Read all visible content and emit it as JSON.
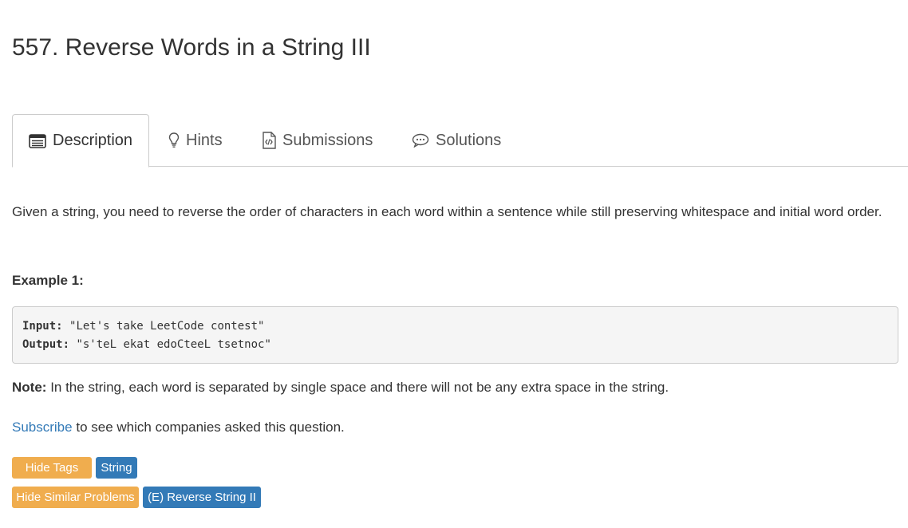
{
  "problem": {
    "title": "557. Reverse Words in a String III"
  },
  "tabs": [
    {
      "label": "Description",
      "icon": "description-icon",
      "active": true
    },
    {
      "label": "Hints",
      "icon": "lightbulb-icon",
      "active": false
    },
    {
      "label": "Submissions",
      "icon": "code-file-icon",
      "active": false
    },
    {
      "label": "Solutions",
      "icon": "chat-bubble-icon",
      "active": false
    }
  ],
  "content": {
    "description": "Given a string, you need to reverse the order of characters in each word within a sentence while still preserving whitespace and initial word order.",
    "example_heading": "Example 1:",
    "example": {
      "input_label": "Input:",
      "input_value": "\"Let's take LeetCode contest\"",
      "output_label": "Output:",
      "output_value": "\"s'teL ekat edoCteeL tsetnoc\""
    },
    "note_label": "Note:",
    "note_text": "In the string, each word is separated by single space and there will not be any extra space in the string.",
    "subscribe_link": "Subscribe",
    "subscribe_text": "to see which companies asked this question."
  },
  "tags": {
    "hide_tags_label": "Hide Tags",
    "items": [
      "String"
    ]
  },
  "similar": {
    "hide_similar_label": "Hide Similar Problems",
    "items": [
      "(E) Reverse String II"
    ]
  },
  "colors": {
    "warning": "#f0ad4e",
    "primary": "#337ab7",
    "link": "#337ab7"
  }
}
